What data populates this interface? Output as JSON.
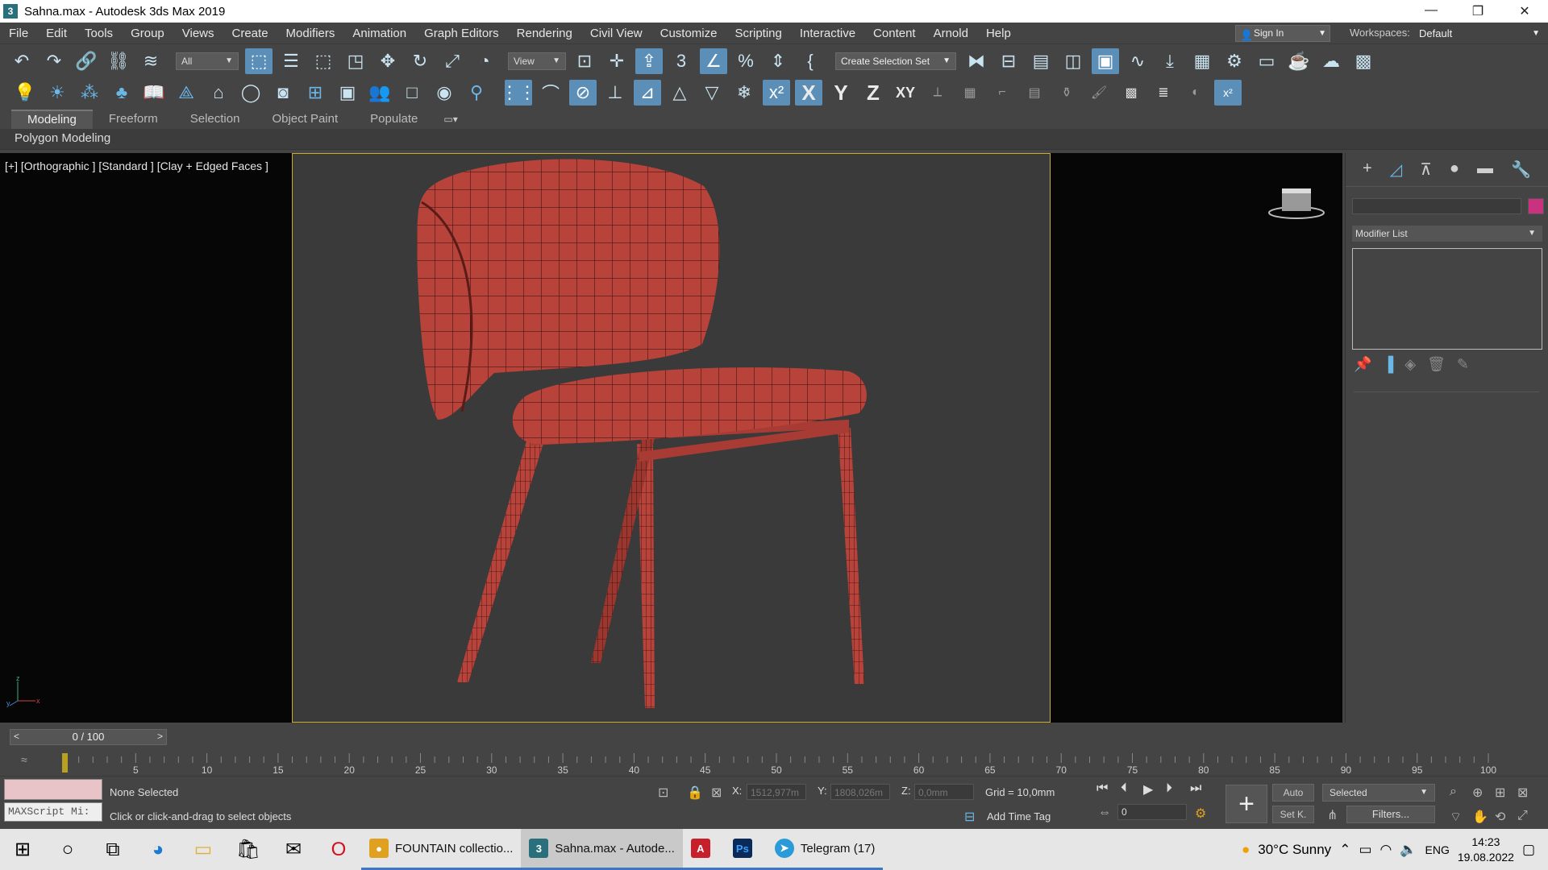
{
  "window": {
    "title": "Sahna.max - Autodesk 3ds Max 2019",
    "app_icon": "3"
  },
  "menu": [
    "File",
    "Edit",
    "Tools",
    "Group",
    "Views",
    "Create",
    "Modifiers",
    "Animation",
    "Graph Editors",
    "Rendering",
    "Civil View",
    "Customize",
    "Scripting",
    "Interactive",
    "Content",
    "Arnold",
    "Help"
  ],
  "account": {
    "sign_in": "Sign In",
    "workspaces_label": "Workspaces:",
    "workspace": "Default"
  },
  "toolbar": {
    "selection_filter": "All",
    "ref_coord": "View",
    "create_selection_set": "Create Selection Set"
  },
  "axis_constraints": {
    "x": "X",
    "y": "Y",
    "z": "Z",
    "xy": "XY"
  },
  "ribbon": {
    "tabs": [
      "Modeling",
      "Freeform",
      "Selection",
      "Object Paint",
      "Populate"
    ],
    "active_tab": "Modeling",
    "panel": "Polygon Modeling"
  },
  "viewport": {
    "label": "[+] [Orthographic ] [Standard ] [Clay + Edged Faces ]",
    "model_color": "#b8433b"
  },
  "command_panel": {
    "modifier_list": "Modifier List",
    "object_color": "#c8327e"
  },
  "time": {
    "slider": "0 / 100",
    "prev": "<",
    "next": ">",
    "ticks": [
      "0",
      "5",
      "10",
      "15",
      "20",
      "25",
      "30",
      "35",
      "40",
      "45",
      "50",
      "55",
      "60",
      "65",
      "70",
      "75",
      "80",
      "85",
      "90",
      "95",
      "100"
    ]
  },
  "status": {
    "selection": "None Selected",
    "prompt": "Click or click-and-drag to select objects",
    "maxscript": "MAXScript Mi:",
    "x_label": "X:",
    "x_value": "1512,977m",
    "y_label": "Y:",
    "y_value": "1808,026m",
    "z_label": "Z:",
    "z_value": "0,0mm",
    "grid": "Grid = 10,0mm",
    "add_time_tag": "Add Time Tag",
    "frame": "0",
    "auto": "Auto",
    "set_key": "Set K.",
    "key_filter": "Selected",
    "filters": "Filters..."
  },
  "taskbar": {
    "apps": [
      {
        "label": "FOUNTAIN collectio...",
        "color": "#e0a020"
      },
      {
        "label": "Sahna.max - Autode...",
        "color": "#2a6f7c"
      },
      {
        "label": "",
        "color": "#c8202a"
      },
      {
        "label": "",
        "color": "#0a2a5a"
      },
      {
        "label": "Telegram (17)",
        "color": "#2a9ad8"
      }
    ],
    "weather": "30°C Sunny",
    "lang": "ENG",
    "time": "14:23",
    "date": "19.08.2022"
  }
}
